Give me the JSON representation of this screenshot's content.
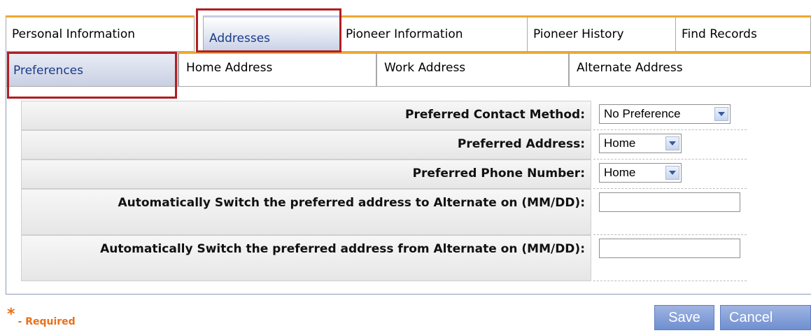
{
  "tabs": [
    {
      "label": "Personal Information",
      "selected": false
    },
    {
      "label": "Addresses",
      "selected": true
    },
    {
      "label": "Pioneer Information",
      "selected": false
    },
    {
      "label": "Pioneer History",
      "selected": false
    },
    {
      "label": "Find Records",
      "selected": false
    }
  ],
  "subtabs": [
    {
      "label": "Preferences",
      "selected": true
    },
    {
      "label": "Home Address",
      "selected": false
    },
    {
      "label": "Work Address",
      "selected": false
    },
    {
      "label": "Alternate Address",
      "selected": false
    }
  ],
  "form": {
    "contact_method": {
      "label": "Preferred Contact Method:",
      "value": "No Preference"
    },
    "preferred_address": {
      "label": "Preferred Address:",
      "value": "Home"
    },
    "preferred_phone": {
      "label": "Preferred Phone Number:",
      "value": "Home"
    },
    "switch_to_alternate": {
      "label": "Automatically Switch the preferred address to Alternate on (MM/DD):",
      "value": ""
    },
    "switch_from_alternate": {
      "label": "Automatically Switch the preferred address from Alternate on (MM/DD):",
      "value": ""
    }
  },
  "footer": {
    "required_star": "*",
    "required_label": "- Required",
    "save_label": "Save",
    "cancel_label": "Cancel"
  },
  "colors": {
    "tab_accent": "#f0a830",
    "selected_text": "#1b3b86",
    "highlight_box": "#b01e22",
    "button": "#7f9bd6",
    "required": "#e8701a"
  }
}
